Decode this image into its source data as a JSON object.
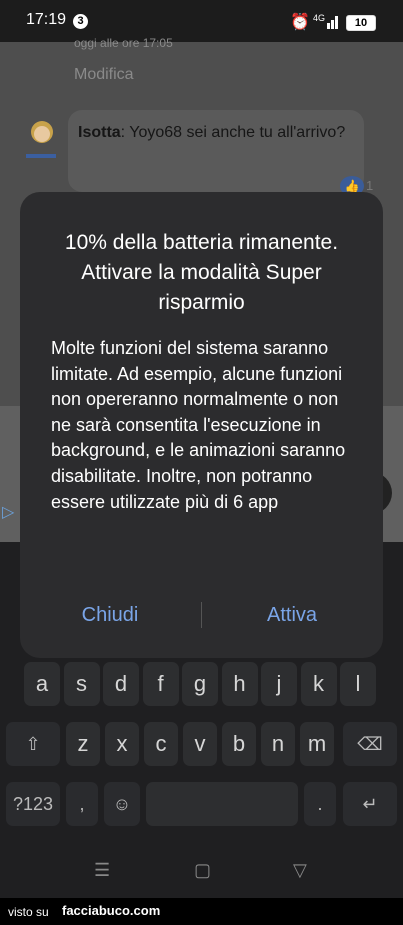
{
  "status_bar": {
    "time": "17:19",
    "notification_count": "3",
    "network": "4G",
    "battery": "10"
  },
  "chat": {
    "date_line": "oggi alle ore 17:05",
    "edit_label": "Modifica",
    "message_author": "Isotta",
    "message_text": ": Yoyo68 sei anche tu all'arrivo?",
    "like_count": "1"
  },
  "dialog": {
    "title": "10% della batteria rimanente. Attivare la modalità Super risparmio",
    "body": "Molte funzioni del sistema saranno limitate. Ad esempio, alcune funzioni non opereranno normalmente o non ne sarà consentita l'esecuzione in background, e le animazioni saranno disabilitate. Inoltre, non potranno essere utilizzate più di 6 app",
    "cancel_label": "Chiudi",
    "confirm_label": "Attiva"
  },
  "keyboard": {
    "row2": [
      "a",
      "s",
      "d",
      "f",
      "g",
      "h",
      "j",
      "k",
      "l"
    ],
    "row3": [
      "z",
      "x",
      "c",
      "v",
      "b",
      "n",
      "m"
    ],
    "symbols_label": "?123",
    "comma": ",",
    "period": "."
  },
  "footer": {
    "seen_on": "visto su",
    "brand": "facciabuco.com"
  },
  "colors": {
    "accent": "#7aa5e8",
    "dialog_bg": "#2c2c2e",
    "keyboard_bg": "#1f1f21"
  }
}
